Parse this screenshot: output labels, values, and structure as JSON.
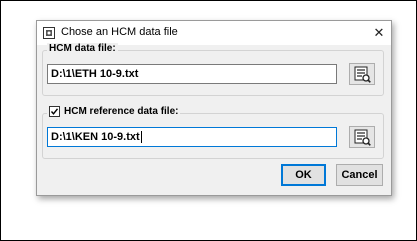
{
  "dialog": {
    "title": "Chose an HCM data file",
    "close_glyph": "✕",
    "app_icon": "app-icon"
  },
  "hcm_group": {
    "label": "HCM data file:",
    "value": "D:\\1\\ETH 10-9.txt",
    "browse_icon": "browse-file-icon"
  },
  "ref_group": {
    "label": "HCM reference data file:",
    "checked": true,
    "value": "D:\\1\\KEN 10-9.txt",
    "browse_icon": "browse-file-icon"
  },
  "buttons": {
    "ok": "OK",
    "cancel": "Cancel"
  },
  "colors": {
    "focus_accent": "#0078d7",
    "dialog_bg": "#f0f0f0"
  }
}
